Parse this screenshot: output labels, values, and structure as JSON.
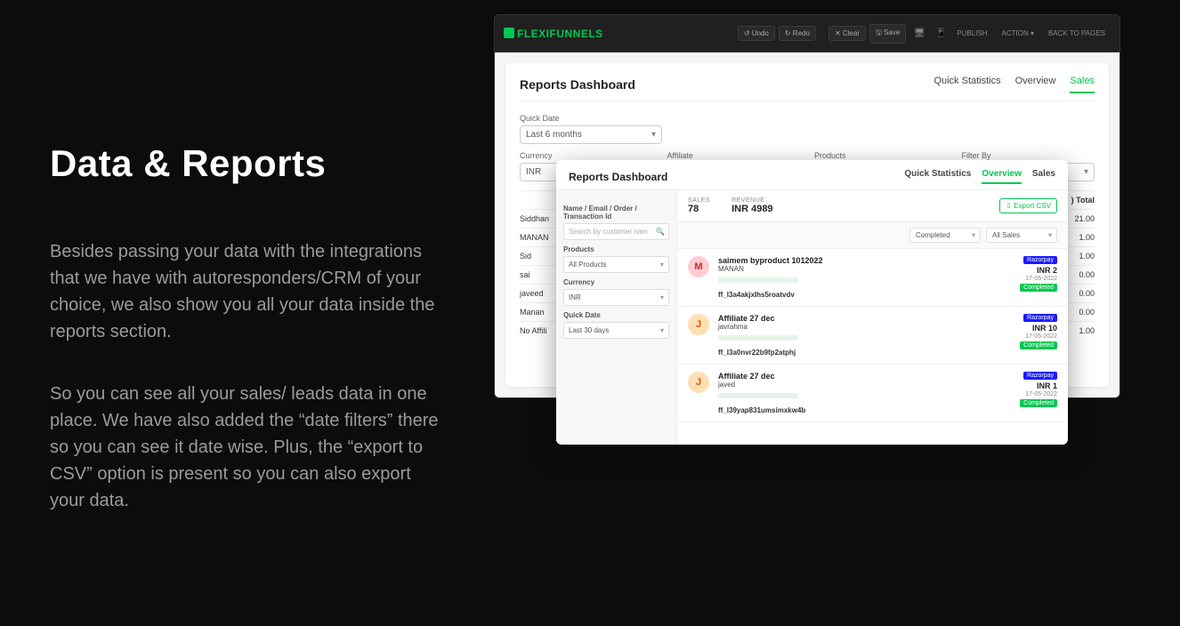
{
  "marketing": {
    "heading": "Data & Reports",
    "para1": "Besides passing your data with the integrations that we have with autoresponders/CRM of your choice, we also show you all your data inside the reports section.",
    "para2": "So you can see all your sales/ leads data in one place. We have also added the “date filters” there so you can see it date wise. Plus, the “export to CSV” option is present so you can also export your data."
  },
  "back_window": {
    "brand1": "FLEXI",
    "brand2": "FUNNELS",
    "toolbar": {
      "undo": "↺ Undo",
      "redo": "↻ Redo",
      "clear": "✕ Clear",
      "save": "🖫 Save",
      "publish": "PUBLISH",
      "action": "ACTION ▾",
      "back": "BACK TO PAGES"
    },
    "title": "Reports Dashboard",
    "tabs": {
      "t1": "Quick Statistics",
      "t2": "Overview",
      "t3": "Sales"
    },
    "filters": {
      "quick_date_label": "Quick Date",
      "quick_date_value": "Last 6 months",
      "currency_label": "Currency",
      "currency_value": "INR",
      "affiliate_label": "Affiliate",
      "products_label": "Products",
      "filterby_label": "Filter By"
    },
    "table": {
      "col_total": ") Total",
      "rows": [
        {
          "name": "Siddhan",
          "v": "21.00"
        },
        {
          "name": "MANAN",
          "v": "1.00"
        },
        {
          "name": "Sid",
          "v": "1.00"
        },
        {
          "name": "sai",
          "v": "0.00"
        },
        {
          "name": "javeed",
          "v": "0.00"
        },
        {
          "name": "Manan",
          "v": "0.00"
        },
        {
          "name": "No Affili",
          "v": "1.00"
        }
      ]
    }
  },
  "overlay": {
    "title": "Reports Dashboard",
    "tabs": {
      "t1": "Quick Statistics",
      "t2": "Overview",
      "t3": "Sales"
    },
    "sidebar": {
      "search_label": "Name / Email / Order / Transaction Id",
      "search_placeholder": "Search by customer nam",
      "products_label": "Products",
      "products_value": "All Products",
      "currency_label": "Currency",
      "currency_value": "INR",
      "quick_date_label": "Quick Date",
      "quick_date_value": "Last 30 days"
    },
    "stats": {
      "sales_label": "SALES",
      "sales_value": "78",
      "revenue_label": "REVENUE",
      "revenue_value": "INR 4989",
      "export_label": "⇩ Export CSV"
    },
    "filters2": {
      "f1": "Completed",
      "f2": "All Sales"
    },
    "items": [
      {
        "avatar": "M",
        "avclass": "av-m",
        "title": "saimem byproduct 1012022",
        "sub": "MANAN",
        "txn": "ff_I3a4akjxIhs5roatvdv",
        "gateway": "Razorpay",
        "amount": "INR 2",
        "date": "17-05-2022",
        "status": "Completed"
      },
      {
        "avatar": "J",
        "avclass": "av-j",
        "title": "Affiliate 27 dec",
        "sub": "javrahma",
        "txn": "ff_I3a0nvr22b9fp2atphj",
        "gateway": "Razorpay",
        "amount": "INR 10",
        "date": "17-05-2022",
        "status": "Completed"
      },
      {
        "avatar": "J",
        "avclass": "av-j",
        "title": "Affiliate 27 dec",
        "sub": "javed",
        "txn": "ff_I39yap831umsimxkw4b",
        "gateway": "Razorpay",
        "amount": "INR 1",
        "date": "17-05-2022",
        "status": "Completed"
      }
    ]
  }
}
